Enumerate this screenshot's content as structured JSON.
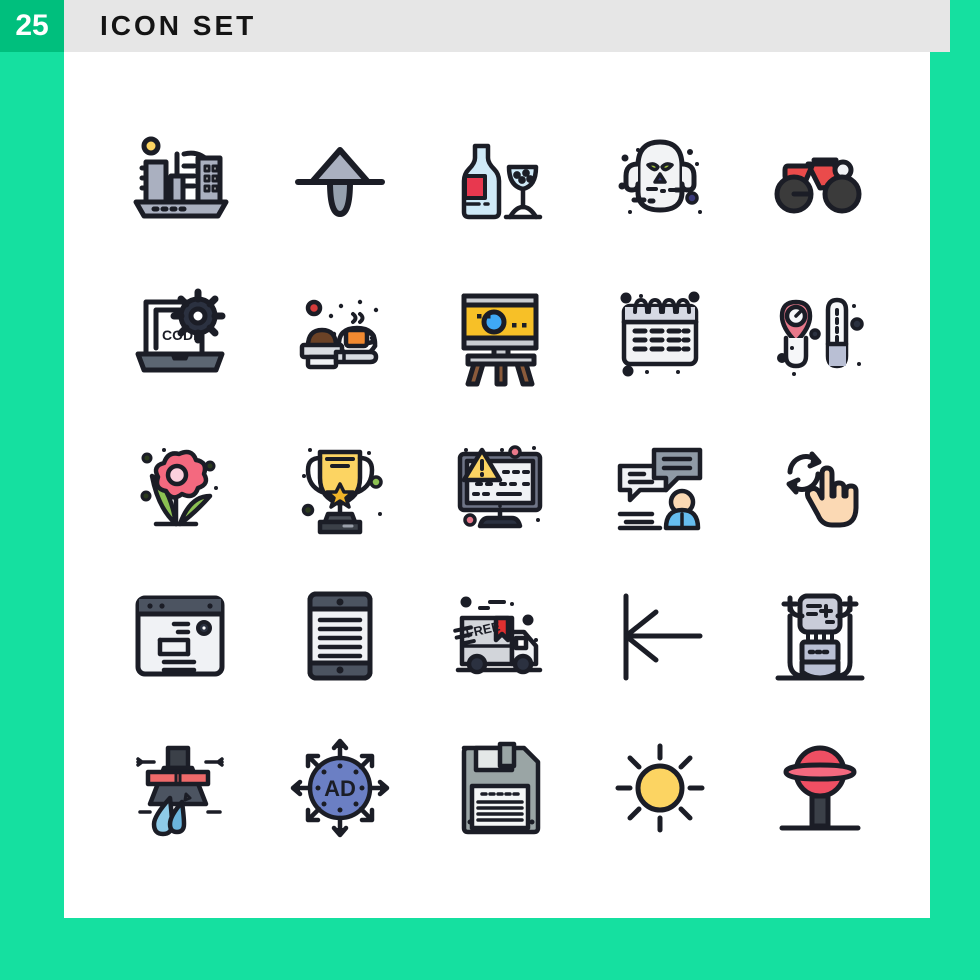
{
  "header": {
    "count": "25",
    "title": "ICON SET",
    "badge_color": "#00bf7d",
    "bar_color": "#e6e6e6",
    "title_color": "#141414",
    "count_color": "#ffffff"
  },
  "page": {
    "background_color": "#15e0a0",
    "canvas_color": "#ffffff",
    "total_icons": 25,
    "columns": 5,
    "rows": 5
  },
  "palette": {
    "outline": "#1b1d26",
    "red": "#ea4b4b",
    "crimson": "#e8384f",
    "pink": "#f4697f",
    "yellow": "#fcd462",
    "gold": "#f7d154",
    "orange": "#f28a30",
    "green": "#8cc152",
    "blue": "#b7e1f5",
    "steel": "#aab0c0",
    "light": "#f0f2f5",
    "grey": "#95a0ae",
    "skin": "#fbd9b4",
    "periwinkle": "#6b7fc4"
  },
  "icons": [
    {
      "row": 1,
      "col": 1,
      "name": "city-buildings-icon",
      "label": "City Buildings"
    },
    {
      "row": 1,
      "col": 2,
      "name": "up-arrow-pin-icon",
      "label": "Up Arrow Pin"
    },
    {
      "row": 1,
      "col": 3,
      "name": "wine-bottle-glass-icon",
      "label": "Wine Bottle and Glass"
    },
    {
      "row": 1,
      "col": 4,
      "name": "ghost-icon",
      "label": "Ghost"
    },
    {
      "row": 1,
      "col": 5,
      "name": "motorbike-icon",
      "label": "Motorbike"
    },
    {
      "row": 2,
      "col": 1,
      "name": "laptop-code-gear-icon",
      "label": "Laptop Code Settings",
      "text": "CODE"
    },
    {
      "row": 2,
      "col": 2,
      "name": "espresso-coffee-icon",
      "label": "Espresso Portafilter and Coffee"
    },
    {
      "row": 2,
      "col": 3,
      "name": "projector-stand-icon",
      "label": "Projector on Stand"
    },
    {
      "row": 2,
      "col": 4,
      "name": "calendar-icon",
      "label": "Spiral Calendar"
    },
    {
      "row": 2,
      "col": 5,
      "name": "thermometer-icon",
      "label": "Hot and Cold Thermometers"
    },
    {
      "row": 3,
      "col": 1,
      "name": "flower-icon",
      "label": "Flower"
    },
    {
      "row": 3,
      "col": 2,
      "name": "trophy-icon",
      "label": "Trophy"
    },
    {
      "row": 3,
      "col": 3,
      "name": "computer-virus-alert-icon",
      "label": "Computer Binary Warning"
    },
    {
      "row": 3,
      "col": 4,
      "name": "chat-support-icon",
      "label": "Chat Support Person"
    },
    {
      "row": 3,
      "col": 5,
      "name": "rotate-gesture-icon",
      "label": "Rotate Hand Gesture"
    },
    {
      "row": 4,
      "col": 1,
      "name": "browser-window-icon",
      "label": "Browser Window Layout"
    },
    {
      "row": 4,
      "col": 2,
      "name": "tablet-text-icon",
      "label": "Tablet with Text"
    },
    {
      "row": 4,
      "col": 3,
      "name": "free-delivery-truck-icon",
      "label": "Free Delivery Truck",
      "text": "FREE"
    },
    {
      "row": 4,
      "col": 4,
      "name": "align-left-arrow-icon",
      "label": "Arrow to Line Left"
    },
    {
      "row": 4,
      "col": 5,
      "name": "robot-icon",
      "label": "Robot"
    },
    {
      "row": 5,
      "col": 1,
      "name": "water-nozzle-drop-icon",
      "label": "Water Pressure Drop"
    },
    {
      "row": 5,
      "col": 2,
      "name": "ad-targeting-icon",
      "label": "Ad Distribution",
      "text": "AD"
    },
    {
      "row": 5,
      "col": 3,
      "name": "floppy-disk-save-icon",
      "label": "Floppy Disk Save"
    },
    {
      "row": 5,
      "col": 4,
      "name": "sun-brightness-icon",
      "label": "Sun Brightness"
    },
    {
      "row": 5,
      "col": 5,
      "name": "lollipop-icon",
      "label": "Lollipop"
    }
  ]
}
